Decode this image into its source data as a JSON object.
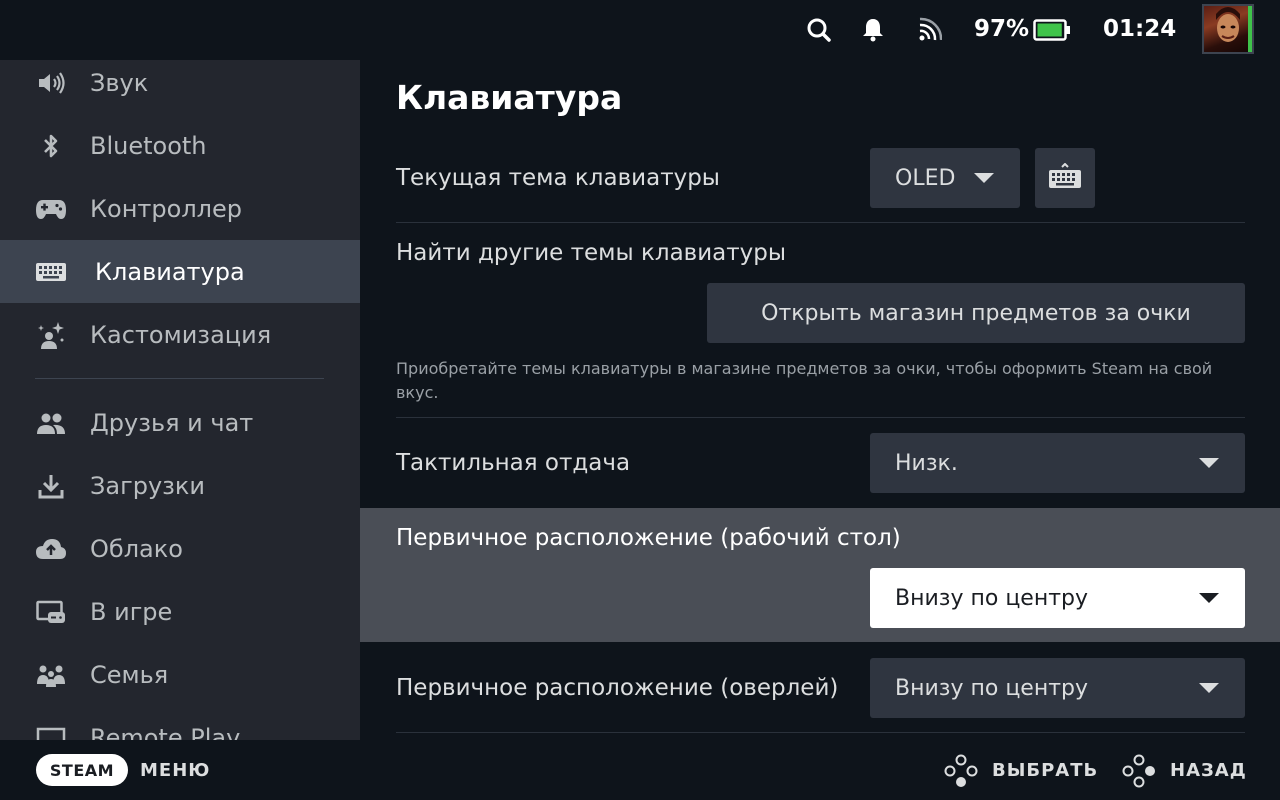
{
  "status_bar": {
    "battery_percent": "97%",
    "battery_level": 0.97,
    "clock": "01:24",
    "icons": [
      "search-icon",
      "bell-icon",
      "wifi-icon",
      "battery-icon"
    ],
    "battery_color": "#3fc34a"
  },
  "sidebar": {
    "items": [
      {
        "label": "Звук",
        "icon": "speaker-icon"
      },
      {
        "label": "Bluetooth",
        "icon": "bluetooth-icon"
      },
      {
        "label": "Контроллер",
        "icon": "gamepad-icon"
      },
      {
        "label": "Клавиатура",
        "icon": "keyboard-icon",
        "active": true
      },
      {
        "label": "Кастомизация",
        "icon": "sparkle-person-icon"
      },
      {
        "label": "Друзья и чат",
        "icon": "friends-icon"
      },
      {
        "label": "Загрузки",
        "icon": "download-icon"
      },
      {
        "label": "Облако",
        "icon": "cloud-icon"
      },
      {
        "label": "В игре",
        "icon": "in-game-icon"
      },
      {
        "label": "Семья",
        "icon": "family-icon"
      },
      {
        "label": "Remote Play",
        "icon": "remote-play-icon"
      }
    ]
  },
  "main": {
    "title": "Клавиатура",
    "theme_row": {
      "label": "Текущая тема клавиатуры",
      "value": "OLED"
    },
    "find_themes": {
      "label": "Найти другие темы клавиатуры",
      "button": "Открыть магазин предметов за очки",
      "description": "Приобретайте темы клавиатуры в магазине предметов за очки, чтобы оформить Steam на свой вкус."
    },
    "haptics_row": {
      "label": "Тактильная отдача",
      "value": "Низк."
    },
    "desktop_position_row": {
      "label": "Первичное расположение (рабочий стол)",
      "value": "Внизу по центру"
    },
    "overlay_position_row": {
      "label": "Первичное расположение (оверлей)",
      "value": "Внизу по центру"
    }
  },
  "bottom_bar": {
    "steam_label": "STEAM",
    "menu_label": "МЕНЮ",
    "select_label": "ВЫБРАТЬ",
    "back_label": "НАЗАД"
  },
  "colors": {
    "background": "#0e141b",
    "sidebar": "#23262e",
    "active_item": "#3d4450",
    "control": "#2f3540",
    "highlight": "#4a4e56"
  }
}
